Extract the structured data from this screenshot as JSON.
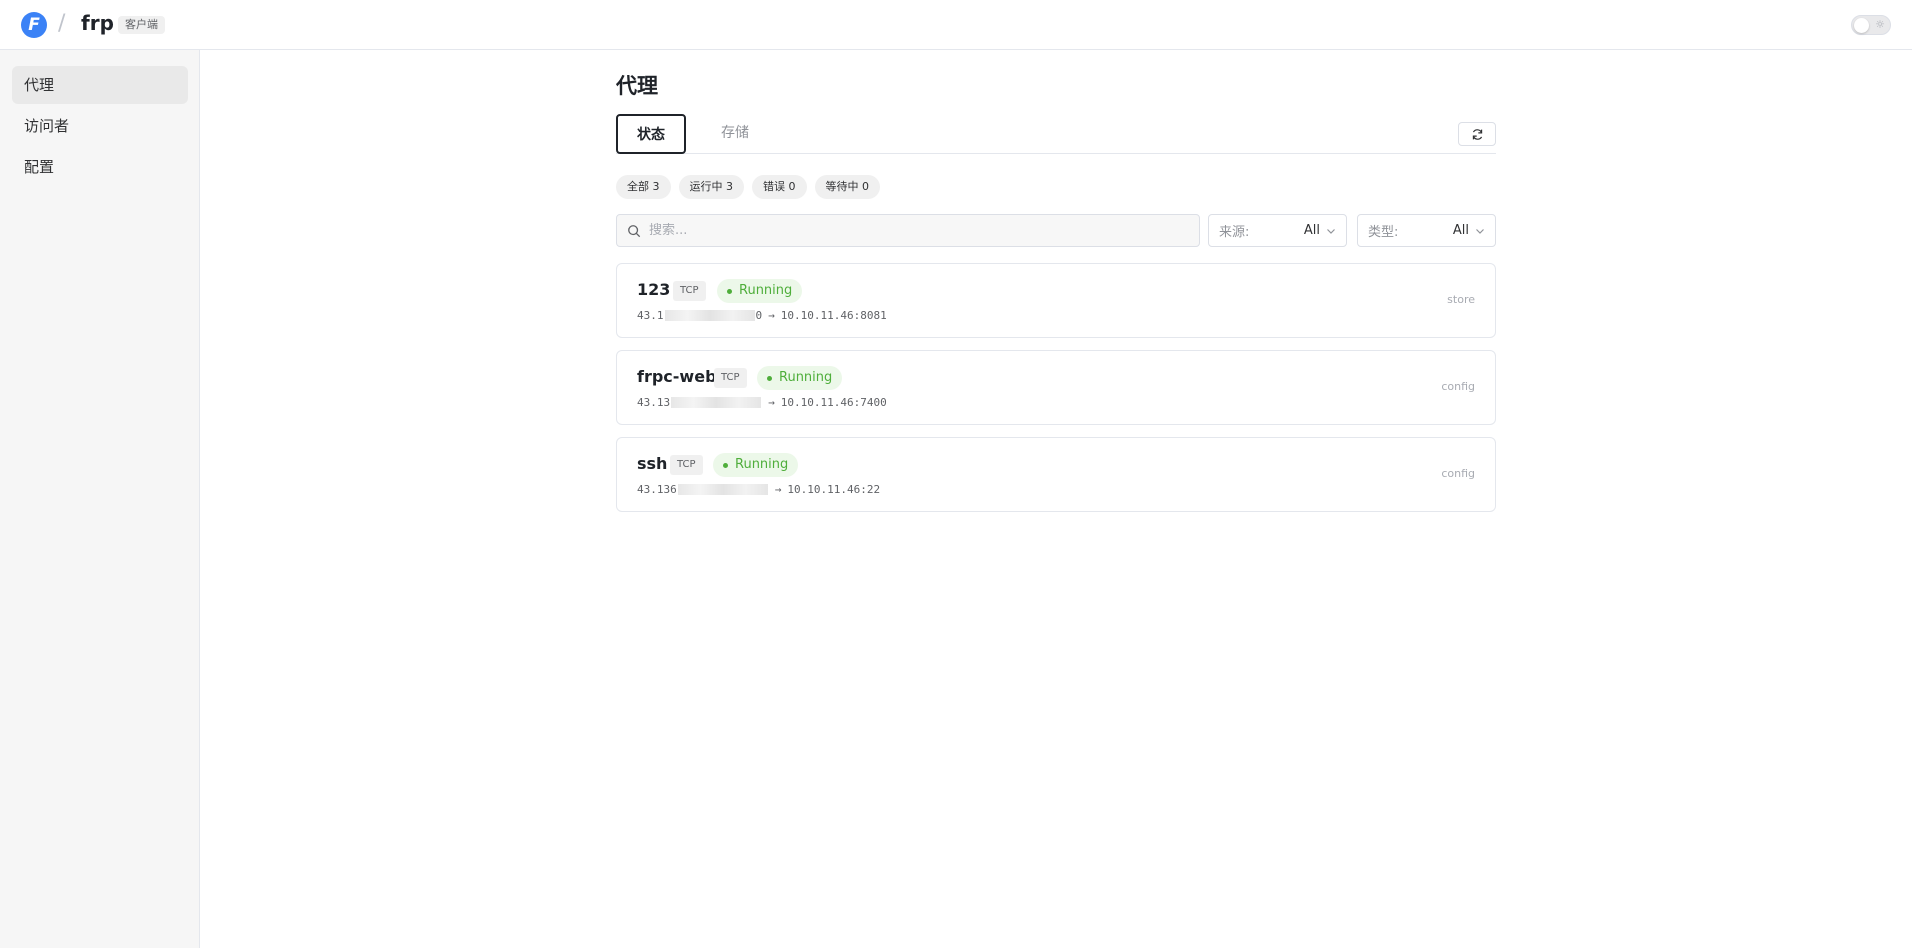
{
  "header": {
    "logo_letter": "F",
    "separator": "/",
    "app_name": "frp",
    "app_badge": "客户端"
  },
  "sidebar": {
    "items": [
      {
        "label": "代理",
        "active": true
      },
      {
        "label": "访问者",
        "active": false
      },
      {
        "label": "配置",
        "active": false
      }
    ]
  },
  "main": {
    "title": "代理",
    "tabs": [
      {
        "label": "状态",
        "active": true
      },
      {
        "label": "存储",
        "active": false
      }
    ],
    "filters": [
      {
        "label": "全部 3"
      },
      {
        "label": "运行中 3"
      },
      {
        "label": "错误 0"
      },
      {
        "label": "等待中 0"
      }
    ],
    "search": {
      "placeholder": "搜索...",
      "value": ""
    },
    "source_select": {
      "label": "来源:",
      "value": "All"
    },
    "type_select": {
      "label": "类型:",
      "value": "All"
    },
    "proxies": [
      {
        "name": "123",
        "type": "TCP",
        "status": "Running",
        "remote_prefix": "43.1",
        "remote_suffix": "0",
        "local": "10.10.11.46:8081",
        "source": "store"
      },
      {
        "name": "frpc-web",
        "type": "TCP",
        "status": "Running",
        "remote_prefix": "43.13",
        "remote_suffix": "",
        "local": "10.10.11.46:7400",
        "source": "config"
      },
      {
        "name": "ssh",
        "type": "TCP",
        "status": "Running",
        "remote_prefix": "43.136",
        "remote_suffix": "",
        "local": "10.10.11.46:22",
        "source": "config"
      }
    ],
    "arrow": "→"
  },
  "colors": {
    "accent": "#1f2329",
    "logo": "#3b82f6",
    "running": "#4fae3b",
    "running_bg": "#ecf8e9"
  },
  "icons": {
    "logo": "frp-logo-icon",
    "theme": "sun-icon",
    "refresh": "refresh-icon",
    "search": "search-icon",
    "chevron": "chevron-down-icon"
  }
}
